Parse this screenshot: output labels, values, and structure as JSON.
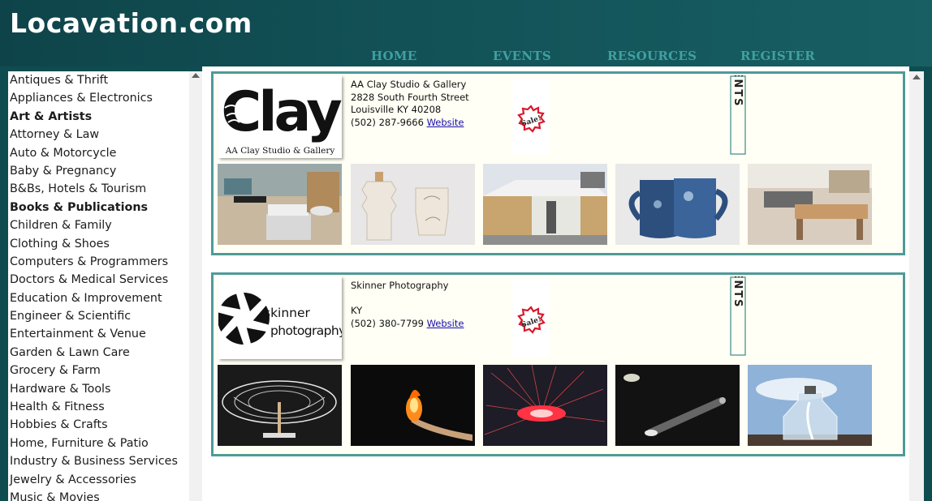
{
  "site": {
    "title": "Locavation.com"
  },
  "nav": [
    {
      "label": "HOME"
    },
    {
      "label": "EVENTS"
    },
    {
      "label": "RESOURCES"
    },
    {
      "label": "REGISTER"
    }
  ],
  "categories": [
    {
      "label": "Antiques & Thrift",
      "bold": false
    },
    {
      "label": "Appliances & Electronics",
      "bold": false
    },
    {
      "label": "Art & Artists",
      "bold": true
    },
    {
      "label": "Attorney & Law",
      "bold": false
    },
    {
      "label": "Auto & Motorcycle",
      "bold": false
    },
    {
      "label": "Baby & Pregnancy",
      "bold": false
    },
    {
      "label": "B&Bs, Hotels & Tourism",
      "bold": false
    },
    {
      "label": "Books & Publications",
      "bold": true
    },
    {
      "label": "Children & Family",
      "bold": false
    },
    {
      "label": "Clothing & Shoes",
      "bold": false
    },
    {
      "label": "Computers & Programmers",
      "bold": false
    },
    {
      "label": "Doctors & Medical Services",
      "bold": false
    },
    {
      "label": "Education & Improvement",
      "bold": false
    },
    {
      "label": "Engineer & Scientific",
      "bold": false
    },
    {
      "label": "Entertainment & Venue",
      "bold": false
    },
    {
      "label": "Garden & Lawn Care",
      "bold": false
    },
    {
      "label": "Grocery & Farm",
      "bold": false
    },
    {
      "label": "Hardware & Tools",
      "bold": false
    },
    {
      "label": "Health & Fitness",
      "bold": false
    },
    {
      "label": "Hobbies & Crafts",
      "bold": false
    },
    {
      "label": "Home, Furniture & Patio",
      "bold": false
    },
    {
      "label": "Industry & Business Services",
      "bold": false
    },
    {
      "label": "Jewelry & Accessories",
      "bold": false
    },
    {
      "label": "Music & Movies",
      "bold": false
    }
  ],
  "listings": [
    {
      "name": "AA Clay Studio & Gallery",
      "address": "2828 South Fourth Street",
      "city": "Louisville KY 40208",
      "phone": "(502) 287-9666",
      "website_label": "Website",
      "logo_text": "Clay",
      "logo_caption": "AA Clay Studio & Gallery",
      "sale_label": "Sale!",
      "events_label": "EVENTS",
      "thumbnails": [
        "studio-tables-photo",
        "ceramic-cups-photo",
        "storefront-photo",
        "blue-mugs-photo",
        "workshop-photo"
      ]
    },
    {
      "name": "Skinner Photography",
      "address": "",
      "city": "KY",
      "phone": "(502) 380-7799",
      "website_label": "Website",
      "logo_text_1": "skinner",
      "logo_text_2": "photography",
      "sale_label": "Sale!",
      "events_label": "EVENTS",
      "thumbnails": [
        "light-sculpture-photo",
        "fire-hand-photo",
        "red-light-photo",
        "light-beam-photo",
        "glass-jar-photo"
      ]
    }
  ],
  "colors": {
    "header_bg": "#0f4c50",
    "nav_text": "#41a0a0",
    "listing_border": "#4f9a98",
    "listing_bg": "#fffff5",
    "sale_red": "#d9182a",
    "link": "#1a0dab"
  }
}
